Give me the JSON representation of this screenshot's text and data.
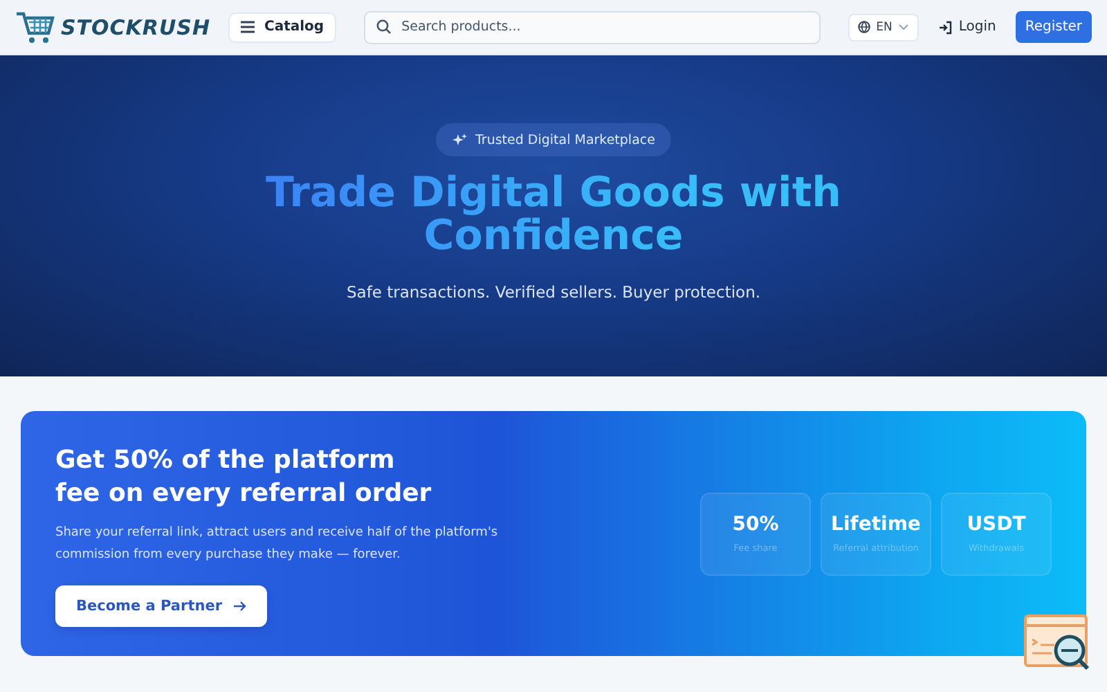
{
  "header": {
    "logo": "STOCKRUSH",
    "catalog": "Catalog",
    "search": {
      "placeholder": "Search products..."
    },
    "language": "EN",
    "login": "Login",
    "register": "Register"
  },
  "hero": {
    "badge": "Trusted Digital Marketplace",
    "title_line_1": "Trade Digital Goods with",
    "title_line_2": "Confidence",
    "subtitle": "Safe transactions. Verified sellers. Buyer protection."
  },
  "referral": {
    "title_line_1": "Get 50% of the platform",
    "title_line_2": "fee on every referral order",
    "description": "Share your referral link, attract users and receive half of the platform's commission from every purchase they make — forever.",
    "button": "Become a Partner",
    "stats": [
      {
        "value": "50%",
        "label": "Fee share"
      },
      {
        "value": "Lifetime",
        "label": "Referral attribution"
      },
      {
        "value": "USDT",
        "label": "Withdrawals"
      }
    ]
  }
}
